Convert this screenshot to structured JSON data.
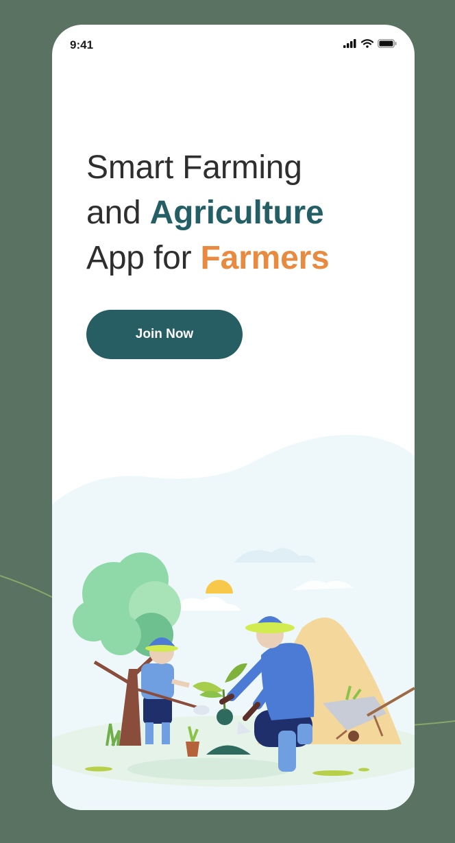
{
  "status_bar": {
    "time": "9:41"
  },
  "hero": {
    "line1": "Smart Farming",
    "line2_prefix": "and ",
    "line2_highlight": "Agriculture",
    "line3_prefix": "App for ",
    "line3_highlight": "Farmers"
  },
  "cta": {
    "join_label": "Join Now"
  },
  "colors": {
    "background": "#5a7262",
    "primary": "#265e64",
    "accent": "#e88a3f",
    "text": "#2e2e2e"
  },
  "icons": [
    "signal-icon",
    "wifi-icon",
    "battery-icon"
  ]
}
